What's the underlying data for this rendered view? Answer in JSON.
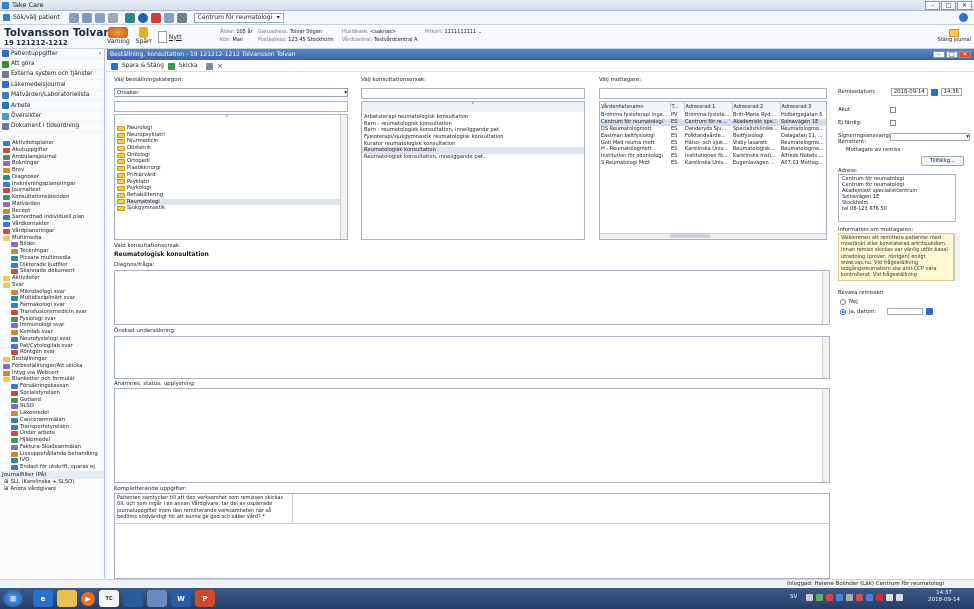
{
  "app": {
    "title": "Take Care"
  },
  "toolbar": {
    "search_patient": "Sök/välj patient",
    "warning": "Varning",
    "spar": "Spärr",
    "nytt": "Nytt",
    "context": "Centrum för reumatologi",
    "close_journal": "Stäng journal"
  },
  "patient": {
    "name": "Tolvansson Tolvan",
    "pnr": "19 121212-1212",
    "age_label": "Ålder:",
    "age": "105 år",
    "sex_label": "Kön:",
    "sex": "Man",
    "addr1_label": "Gatuadress:",
    "addr1": "Tolvar Stigen",
    "addr2_label": "Postadress:",
    "addr2": "123 45 Stockholm",
    "guardian_label": "Husläkare:",
    "guardian": "<saknas>",
    "unit_label": "Vårdcentral:",
    "unit": "Testvårdcentral A",
    "reg_label": "Prikort:",
    "reg": "1111111111"
  },
  "sidebar": {
    "items": [
      "Patientuppgifter",
      "Att göra",
      "Externa system och tjänster",
      "Läkemedelsjournal",
      "Mätvärden/Laboratorielista",
      "Arbete",
      "Översikter",
      "Dokument i tidsordning"
    ],
    "tree": [
      "Aktivitetsplaner",
      "Akutuppgifter",
      "Ambulansjournal",
      "Bokningar",
      "Brev",
      "Diagnoser",
      "Insknivningsplaneringar",
      "Journaltext",
      "Konsultationsärenden",
      "Mätvärden",
      "Recept",
      "Samordnad individuell plan",
      "Vårdkontakter",
      "Vårdplaneringar",
      "Multimedia",
      "Bilder",
      "Teckningar",
      "Picsara multimedia",
      "Dikterade ljudfiler",
      "Skannade dokument",
      "Aktiviteter",
      "Svar",
      "Mikrobiologi svar",
      "Multidisciplinärt svar",
      "Farmakologi svar",
      "Transfusionsmedicin svar",
      "Fysiologi svar",
      "Immunologi svar",
      "Kemlab svar",
      "Neurofysiologi svar",
      "Pat/Cytologilab svar",
      "Röntgen svar",
      "Beställningar",
      "Förbeställningar/Att skicka",
      "Intyg via Webcert",
      "Blanketter och formulär",
      "Försäkringskassan",
      "Socialstyrelsen",
      "Gotland",
      "SLSO",
      "Läkemedel",
      "Cancerannmälan",
      "Transportstyrelsen",
      "Under arbete",
      "Hjälpmedel",
      "Faktura-Skadeanmälan",
      "Livsuppehållande behandling",
      "IVO",
      "Endast för utskrift, sparas ej"
    ],
    "journal_label": "Journalfilter (På)",
    "journal": [
      "SLL (Karolinska + SLSO)",
      "Andra vårdgivare"
    ]
  },
  "main": {
    "header": "Beställning, konsultation - 19 121212-1212 Tolvansson Tolvan",
    "save_send": "Spara & Stäng",
    "send": "Skicka",
    "cat_label": "Välj beställningskategori:",
    "cat_value": "Orsaker",
    "folders": [
      "Neurologi",
      "Neuropsykiatri",
      "Njurmedicin",
      "Obstetrik",
      "Onkologi",
      "Ortopedi",
      "Plastikkirurgi",
      "Primärvård",
      "Psykiatri",
      "Psykologi",
      "Rehabilitering",
      "Reumatologi",
      "Sjukgymnastik"
    ],
    "reason_label": "Välj konsultationsorsak:",
    "reasons": [
      "Arbetsterapi reumatologisk konsultation",
      "Barn - reumatologisk konsultation",
      "Barn - reumatologisk konsultation, inneliggande pat.",
      "Fysioterapi/sjukgymnastik reumatologisk konsultation",
      "Kurator reumatologisk konsultation",
      "Reumatologisk konsultation",
      "Reumatologisk konsultation, inneliggande pat."
    ],
    "recipient_label": "Välj mottagare:",
    "cols": [
      "Vårdenhetsnamn",
      "T...",
      "Adressrad 1",
      "Adressrad 2",
      "Adressrad 3"
    ],
    "rows": [
      [
        "Bromma fysioterapi Inga...",
        "PV",
        "Bromma fysiote...",
        "Britt-Marie Ryd...",
        "Holbergsgatan 5"
      ],
      [
        "Centrum för reumatologi",
        "ES",
        "Centrum för re...",
        "Akademiskt spe...",
        "Solnavägen 1E"
      ],
      [
        "DS Reumatologmott",
        "ES",
        "Danderyds Sju...",
        "Specialistklinike...",
        "Reumatologmo..."
      ],
      [
        "Eastman beltfysiologi",
        "ES",
        "Folktandvårde...",
        "Beltfysiologi",
        "Dalagatan 11, ..."
      ],
      [
        "Gotl Med reuma mott",
        "ES",
        "Hälso- och sjuk...",
        "Visby lasarett",
        "Reumatologmo..."
      ],
      [
        "H - Reumatologmott",
        "ES",
        "Karolinska Univ...",
        "Reumatologisk...",
        "Reumatologmo..."
      ],
      [
        "Institution för odontologi",
        "ES",
        "Institutionen fö...",
        "Karolinska Insti...",
        "Alfreds Nobels ..."
      ],
      [
        "S Reumatologi Mott",
        "ES",
        "Karolinska Univ...",
        "Eugeniavägen ...",
        "A07:01 Mottag..."
      ]
    ],
    "chosen_label": "Vald konsultationsorsak:",
    "chosen": "Reumatologisk konsultation",
    "diag_label": "Diagnos/fråga:",
    "wish_label": "Önskad undersökning:",
    "anam_label": "Anamnes, status, upplysning:",
    "extra_label": "Kompletterande uppgifter:",
    "extra": "Patienten samtycker till att den verksamhet som remissen skickas till, och som ingår i en annan Vårdgivare, tar del av ospärrade journaluppgifter inom den remitterande verksamheten när så bedöms nödvändigt för att kunna ge god och säker vård? *",
    "right": {
      "date_label": "Remissdatum:",
      "date": "2018-09-14",
      "time": "14:36",
      "akut": "Akut:",
      "ej_fardig": "Ej färdig:",
      "sign_label": "Signeringsansvarig/ Remittent:",
      "mottagare": "Mottagare av remiss",
      "tillfallig": "Tillfällig...",
      "adress_label": "Adress:",
      "adress": [
        "Centrum för reumatologi",
        "Centrum för reumatologi",
        "Akademiskt specialistcentrum",
        "Solnavägen 1E",
        "Stockholm",
        "tel 08-123 676 50"
      ],
      "info_label": "Information om mottagaren:",
      "info": "Välkommen att remittera patienter med misstänkt eller konstaterad artritsjukdom. Innan remiss skickas var vänlig utför basal utredning (prover, röntgen) enligt www.vas.nu. Vid frågeställning ledgångsreumatism ska anti-CCP vara kontrollerat. Vid frågeställning",
      "bevaka": "Bevaka remissen",
      "nej": "Nej",
      "ja": "Ja, datum:"
    }
  },
  "status": {
    "logged": "Inloggad: Helene Bolinder (Läk) Centrum för reumatologi"
  },
  "taskbar": {
    "lang": "SV",
    "time": "14:37",
    "date": "2018-09-14"
  },
  "colors": {
    "header": "#3a66a8",
    "selection": "#cfe0f5",
    "folder": "#f3c94e",
    "taskbar": "#243e66"
  }
}
